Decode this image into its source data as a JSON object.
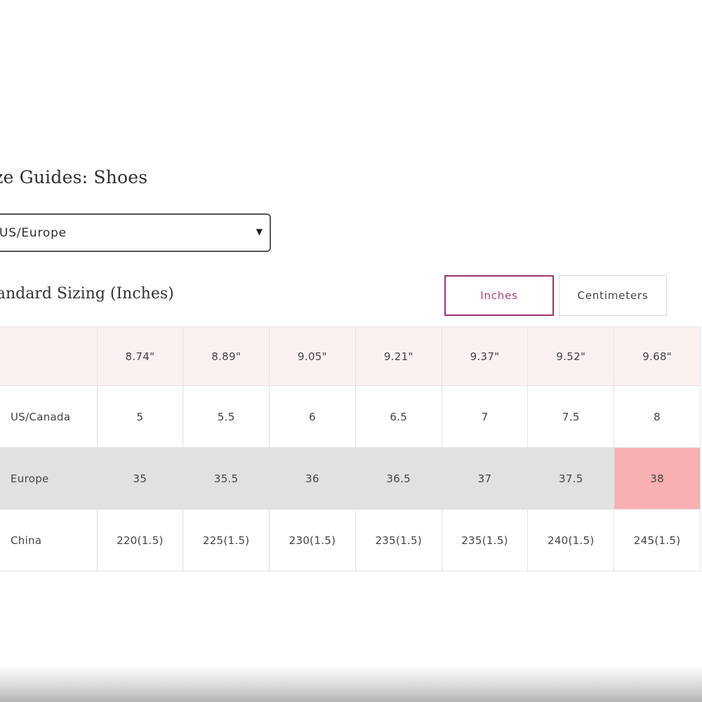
{
  "page": {
    "title": "ize Guides: Shoes"
  },
  "region_select": {
    "value": "US/Europe",
    "arrow": "▼"
  },
  "section": {
    "title": "tandard Sizing (Inches)"
  },
  "unit_toggle": {
    "inches_label": "Inches",
    "centimeters_label": "Centimeters",
    "selected": "Inches",
    "selected_color": "#a0326e"
  },
  "size_table": {
    "header_label": "",
    "columns": [
      "8.74\"",
      "8.89\"",
      "9.05\"",
      "9.21\"",
      "9.37\"",
      "9.52\"",
      "9.68\""
    ],
    "rows": [
      {
        "label": "US/Canada",
        "values": [
          "5",
          "5.5",
          "6",
          "6.5",
          "7",
          "7.5",
          "8"
        ]
      },
      {
        "label": "Europe",
        "values": [
          "35",
          "35.5",
          "36",
          "36.5",
          "37",
          "37.5",
          "38"
        ]
      },
      {
        "label": "China",
        "values": [
          "220(1.5)",
          "225(1.5)",
          "230(1.5)",
          "235(1.5)",
          "235(1.5)",
          "240(1.5)",
          "245(1.5)"
        ]
      }
    ],
    "highlighted_row": "Europe",
    "highlighted_cell_value": "38",
    "highlight_color": "#f8b0b2",
    "header_bg_color": "#fcf1f1"
  }
}
